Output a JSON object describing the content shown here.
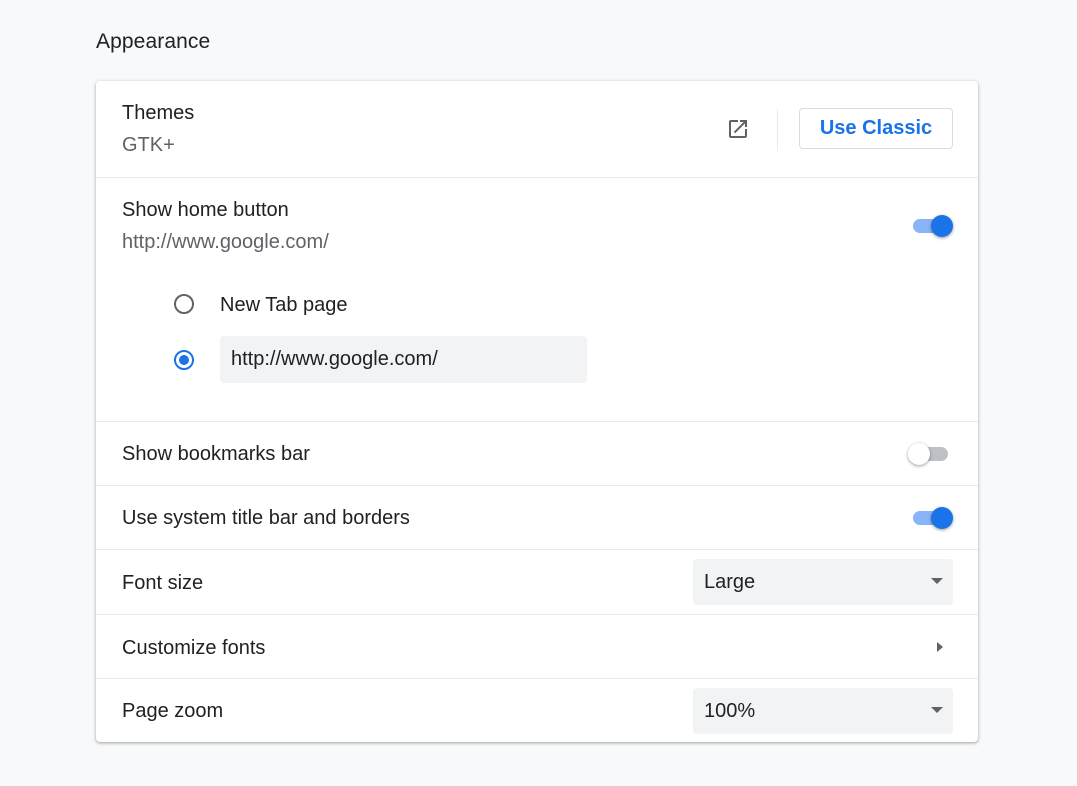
{
  "section": {
    "title": "Appearance"
  },
  "themes": {
    "label": "Themes",
    "value": "GTK+",
    "open_icon": "open-in-new-icon",
    "button_label": "Use Classic"
  },
  "home_button": {
    "label": "Show home button",
    "value": "http://www.google.com/",
    "enabled": true,
    "options": {
      "new_tab_label": "New Tab page",
      "custom_url_value": "http://www.google.com/"
    },
    "selected_option": "custom_url"
  },
  "bookmarks_bar": {
    "label": "Show bookmarks bar",
    "enabled": false
  },
  "system_title_bar": {
    "label": "Use system title bar and borders",
    "enabled": true
  },
  "font_size": {
    "label": "Font size",
    "selected": "Large"
  },
  "customize_fonts": {
    "label": "Customize fonts",
    "icon": "arrow-right-icon"
  },
  "page_zoom": {
    "label": "Page zoom",
    "selected": "100%"
  },
  "colors": {
    "accent": "#1a73e8",
    "toggle_track_on": "#8ab4f8",
    "toggle_track_off": "#bdc1c6",
    "secondary_text": "#5f6368",
    "field_background": "#f1f3f4"
  }
}
